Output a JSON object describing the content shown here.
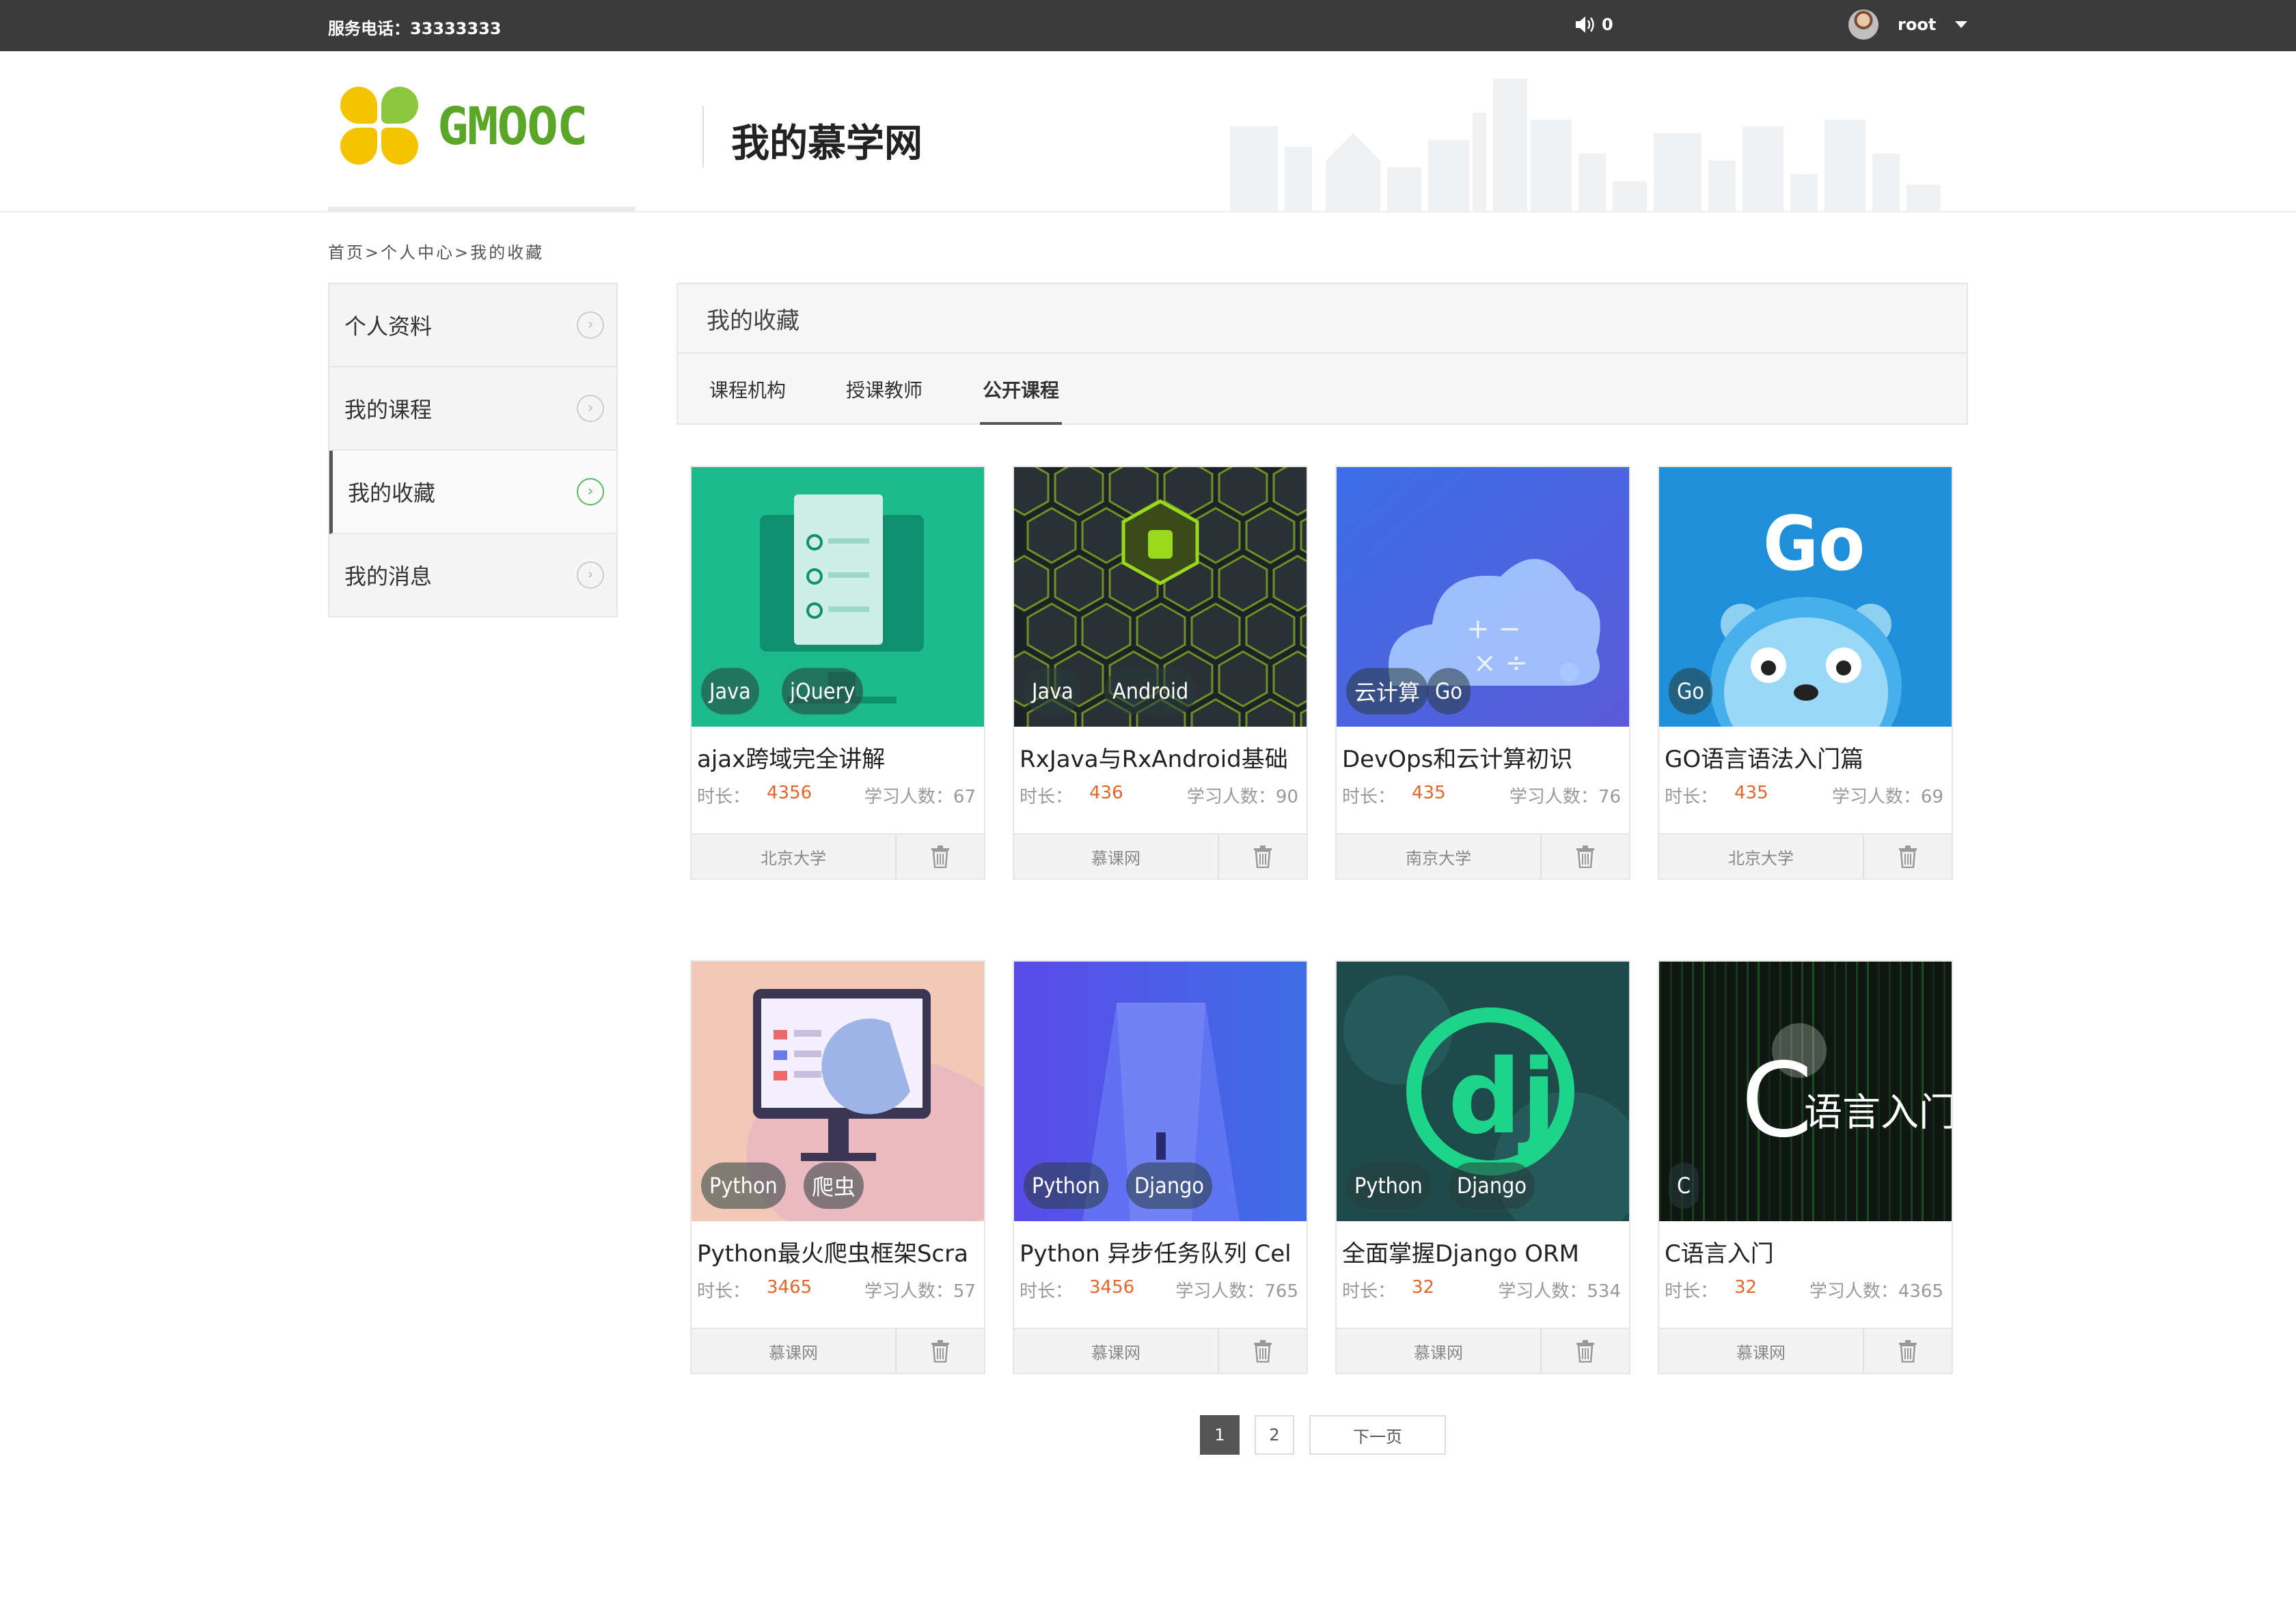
{
  "topbar": {
    "service_phone": "服务电话：33333333",
    "message_count": "0",
    "username": "root",
    "icons": {
      "speaker": "speaker-icon",
      "caret": "caret-down-icon",
      "avatar": "avatar"
    }
  },
  "header": {
    "logo_text": "GMOOC",
    "page_title": "我的慕学网"
  },
  "breadcrumb": {
    "items": [
      "首页",
      "个人中心",
      "我的收藏"
    ],
    "separator": ">"
  },
  "sidebar": {
    "items": [
      {
        "label": "个人资料"
      },
      {
        "label": "我的课程"
      },
      {
        "label": "我的收藏"
      },
      {
        "label": "我的消息"
      }
    ],
    "active": "我的收藏",
    "chevron": "›"
  },
  "panel": {
    "title": "我的收藏",
    "tabs": [
      {
        "label": "课程机构"
      },
      {
        "label": "授课教师"
      },
      {
        "label": "公开课程"
      }
    ],
    "active_tab": "公开课程"
  },
  "labels": {
    "duration": "时长：",
    "students": "学习人数："
  },
  "courses": [
    {
      "title": "ajax跨域完全讲解",
      "duration": "4356",
      "students": "67",
      "org": "北京大学",
      "tags": [
        "Java",
        "jQuery"
      ],
      "colors": [
        "#1cb98a",
        "#0e8f6e"
      ]
    },
    {
      "title": "RxJava与RxAndroid基础",
      "duration": "436",
      "students": "90",
      "org": "慕课网",
      "tags": [
        "Java",
        "Android"
      ],
      "colors": [
        "#1d2226",
        "#9ad81e"
      ]
    },
    {
      "title": "DevOps和云计算初识",
      "duration": "435",
      "students": "76",
      "org": "南京大学",
      "tags": [
        "云计算",
        "Go"
      ],
      "colors": [
        "#3d6ee8",
        "#5a5ad8"
      ]
    },
    {
      "title": "GO语言语法入门篇",
      "duration": "435",
      "students": "69",
      "org": "北京大学",
      "tags": [
        "Go"
      ],
      "colors": [
        "#1e8fd8",
        "#47b0ea"
      ]
    },
    {
      "title": "Python最火爬虫框架Scra",
      "duration": "3465",
      "students": "57",
      "org": "慕课网",
      "tags": [
        "Python",
        "爬虫"
      ],
      "colors": [
        "#f2c9b6",
        "#e8b4c6"
      ]
    },
    {
      "title": "Python 异步任务队列 Cel",
      "duration": "3456",
      "students": "765",
      "org": "慕课网",
      "tags": [
        "Python",
        "Django"
      ],
      "colors": [
        "#5a4be8",
        "#3f6ee6"
      ]
    },
    {
      "title": "全面掌握Django ORM",
      "duration": "32",
      "students": "534",
      "org": "慕课网",
      "tags": [
        "Python",
        "Django"
      ],
      "colors": [
        "#1e4a4a",
        "#1ed38a"
      ]
    },
    {
      "title": "C语言入门",
      "duration": "32",
      "students": "4365",
      "org": "慕课网",
      "tags": [
        "C"
      ],
      "colors": [
        "#0f1712",
        "#2a6b2a"
      ]
    }
  ],
  "thumb_text": {
    "go": "Go",
    "c_big": "C",
    "c_rest": "语言入门",
    "dj": "dj"
  },
  "pagination": {
    "pages": [
      "1",
      "2"
    ],
    "active": "1",
    "next": "下一页"
  }
}
